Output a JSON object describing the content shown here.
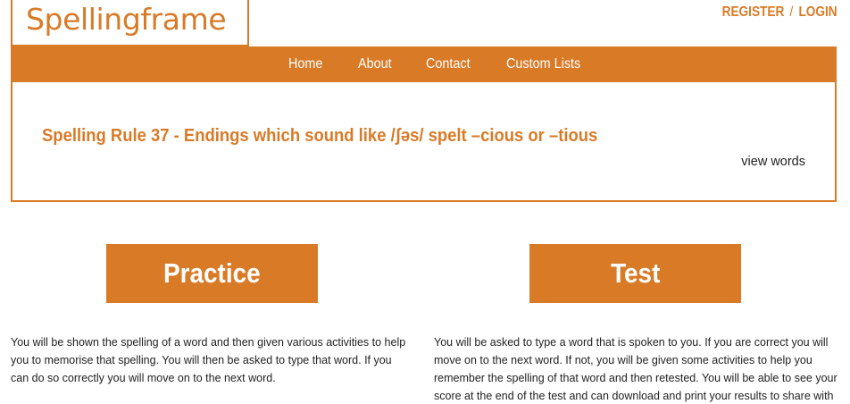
{
  "brand": {
    "logo_text": "Spellingframe",
    "accent_color": "#d97a27"
  },
  "auth": {
    "register_label": "REGISTER",
    "separator": "/",
    "login_label": "LOGIN"
  },
  "nav": {
    "items": [
      {
        "label": "Home"
      },
      {
        "label": "About"
      },
      {
        "label": "Contact"
      },
      {
        "label": "Custom Lists"
      }
    ]
  },
  "rule": {
    "title": "Spelling Rule 37 - Endings which sound like /ʃəs/ spelt –cious or –tious",
    "view_words_label": "view words"
  },
  "practice": {
    "button_label": "Practice",
    "description": "You will be shown the spelling of a word and then given various activities to help you to memorise that spelling. You will then be asked to type that word. If you can do so correctly you will move on to the next word."
  },
  "test": {
    "button_label": "Test",
    "description": "You will be asked to type a word that is spoken to you. If you are correct you will move on to the next word. If not, you will be given some activities to help you remember the spelling of that word and then retested. You will be able to see your score at the end of the test and can download and print your results to share with your teacher."
  }
}
